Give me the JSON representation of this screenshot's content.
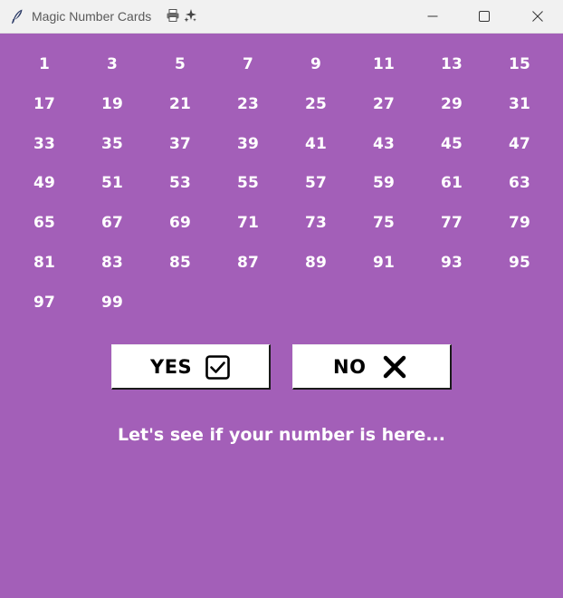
{
  "window": {
    "title": "Magic Number Cards",
    "title_icons": [
      "feather-icon",
      "printer-icon",
      "sparkles-icon"
    ],
    "controls": [
      "minimize-icon",
      "maximize-icon",
      "close-icon"
    ]
  },
  "card": {
    "numbers": [
      "1",
      "3",
      "5",
      "7",
      "9",
      "11",
      "13",
      "15",
      "17",
      "19",
      "21",
      "23",
      "25",
      "27",
      "29",
      "31",
      "33",
      "35",
      "37",
      "39",
      "41",
      "43",
      "45",
      "47",
      "49",
      "51",
      "53",
      "55",
      "57",
      "59",
      "61",
      "63",
      "65",
      "67",
      "69",
      "71",
      "73",
      "75",
      "77",
      "79",
      "81",
      "83",
      "85",
      "87",
      "89",
      "91",
      "93",
      "95",
      "97",
      "99"
    ]
  },
  "buttons": {
    "yes_label": "YES",
    "yes_icon": "checkbox-icon",
    "no_label": "NO",
    "no_icon": "x-icon"
  },
  "message": "Let's see if your number is here...",
  "colors": {
    "background": "#a35fb8",
    "text": "#ffffff",
    "button_bg": "#ffffff",
    "button_text": "#000000"
  }
}
